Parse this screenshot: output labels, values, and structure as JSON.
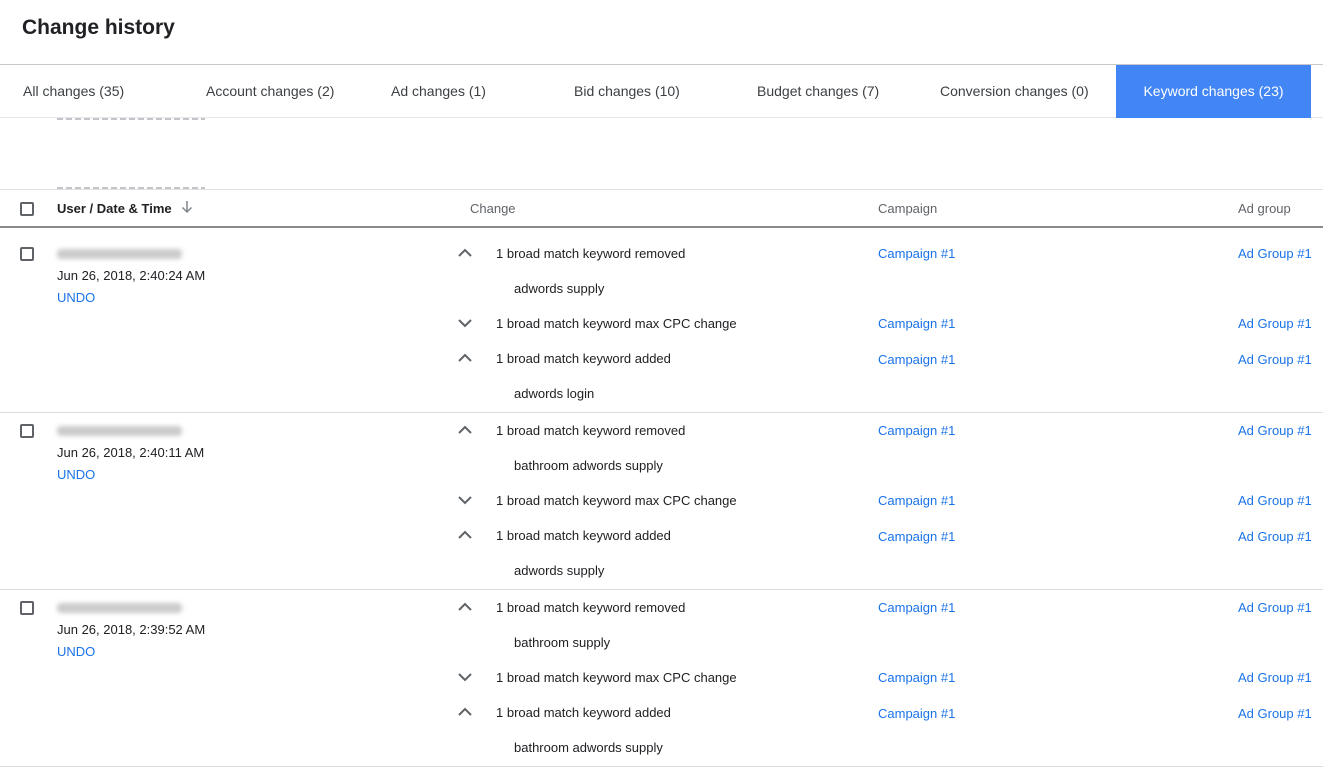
{
  "page_title": "Change history",
  "tabs": [
    {
      "label": "All changes (35)",
      "active": false
    },
    {
      "label": "Account changes (2)",
      "active": false
    },
    {
      "label": "Ad changes (1)",
      "active": false
    },
    {
      "label": "Bid changes (10)",
      "active": false
    },
    {
      "label": "Budget changes (7)",
      "active": false
    },
    {
      "label": "Conversion changes (0)",
      "active": false
    },
    {
      "label": "Keyword changes (23)",
      "active": true
    }
  ],
  "colors": {
    "accent": "#4285f4",
    "link": "#1a73e8"
  },
  "table": {
    "headers": {
      "user_date_time": "User / Date & Time",
      "change": "Change",
      "campaign": "Campaign",
      "ad_group": "Ad group"
    },
    "sort_icon": "arrow-down-icon",
    "groups": [
      {
        "date": "Jun 26, 2018, 2:40:24 AM",
        "undo": "UNDO",
        "changes": [
          {
            "expanded": true,
            "text": "1 broad match keyword removed",
            "detail": "adwords supply",
            "campaign": "Campaign #1",
            "ad_group": "Ad Group #1"
          },
          {
            "expanded": false,
            "text": "1 broad match keyword max CPC change",
            "detail": "",
            "campaign": "Campaign #1",
            "ad_group": "Ad Group #1"
          },
          {
            "expanded": true,
            "text": "1 broad match keyword added",
            "detail": "adwords login",
            "campaign": "Campaign #1",
            "ad_group": "Ad Group #1"
          }
        ]
      },
      {
        "date": "Jun 26, 2018, 2:40:11 AM",
        "undo": "UNDO",
        "changes": [
          {
            "expanded": true,
            "text": "1 broad match keyword removed",
            "detail": "bathroom adwords supply",
            "campaign": "Campaign #1",
            "ad_group": "Ad Group #1"
          },
          {
            "expanded": false,
            "text": "1 broad match keyword max CPC change",
            "detail": "",
            "campaign": "Campaign #1",
            "ad_group": "Ad Group #1"
          },
          {
            "expanded": true,
            "text": "1 broad match keyword added",
            "detail": "adwords supply",
            "campaign": "Campaign #1",
            "ad_group": "Ad Group #1"
          }
        ]
      },
      {
        "date": "Jun 26, 2018, 2:39:52 AM",
        "undo": "UNDO",
        "changes": [
          {
            "expanded": true,
            "text": "1 broad match keyword removed",
            "detail": "bathroom supply",
            "campaign": "Campaign #1",
            "ad_group": "Ad Group #1"
          },
          {
            "expanded": false,
            "text": "1 broad match keyword max CPC change",
            "detail": "",
            "campaign": "Campaign #1",
            "ad_group": "Ad Group #1"
          },
          {
            "expanded": true,
            "text": "1 broad match keyword added",
            "detail": "bathroom adwords supply",
            "campaign": "Campaign #1",
            "ad_group": "Ad Group #1"
          }
        ]
      }
    ]
  }
}
